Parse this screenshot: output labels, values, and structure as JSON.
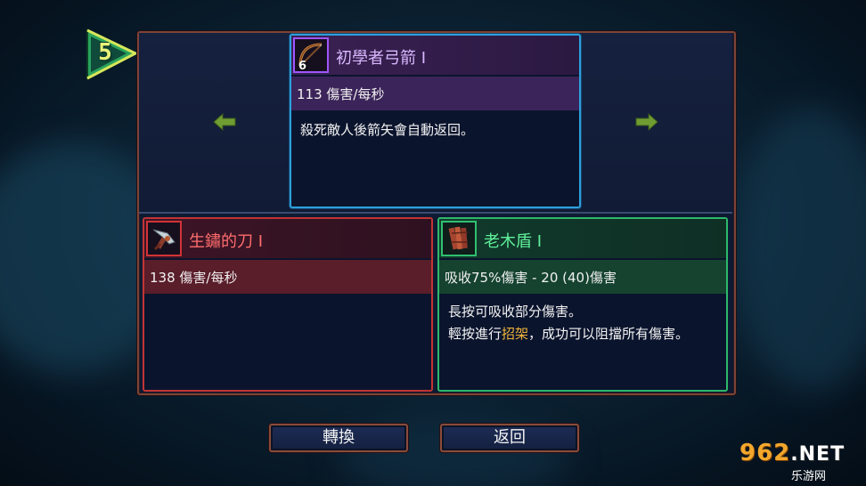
{
  "level": {
    "value": "5"
  },
  "colors": {
    "bow_accent": "#2d9fdc",
    "bow_rarity": "#9f56ff",
    "blade_accent": "#c23435",
    "shield_accent": "#2db86a",
    "highlight": "#f0b53a"
  },
  "nav": {
    "prev_icon": "arrow-left-icon",
    "next_icon": "arrow-right-icon"
  },
  "cards": {
    "bow": {
      "icon": "bow-icon",
      "count": "6",
      "title": "初學者弓箭 I",
      "stat": "113 傷害/每秒",
      "desc": "殺死敵人後箭矢會自動返回。"
    },
    "blade": {
      "icon": "rusty-blade-icon",
      "title": "生鏽的刀 I",
      "stat": "138 傷害/每秒"
    },
    "shield": {
      "icon": "wooden-shield-icon",
      "title": "老木盾 I",
      "stat_pre": "吸收75%傷害 - 20 (",
      "stat_hl": "40",
      "stat_post": ")傷害",
      "desc_line1": "長按可吸收部分傷害。",
      "desc_line2_pre": "輕按進行",
      "desc_line2_hl": "招架",
      "desc_line2_post": "，成功可以阻擋所有傷害。"
    }
  },
  "buttons": {
    "swap": "轉換",
    "back": "返回"
  },
  "watermark": {
    "brand": "962",
    "tld": ".NET",
    "sub": "乐游网"
  }
}
